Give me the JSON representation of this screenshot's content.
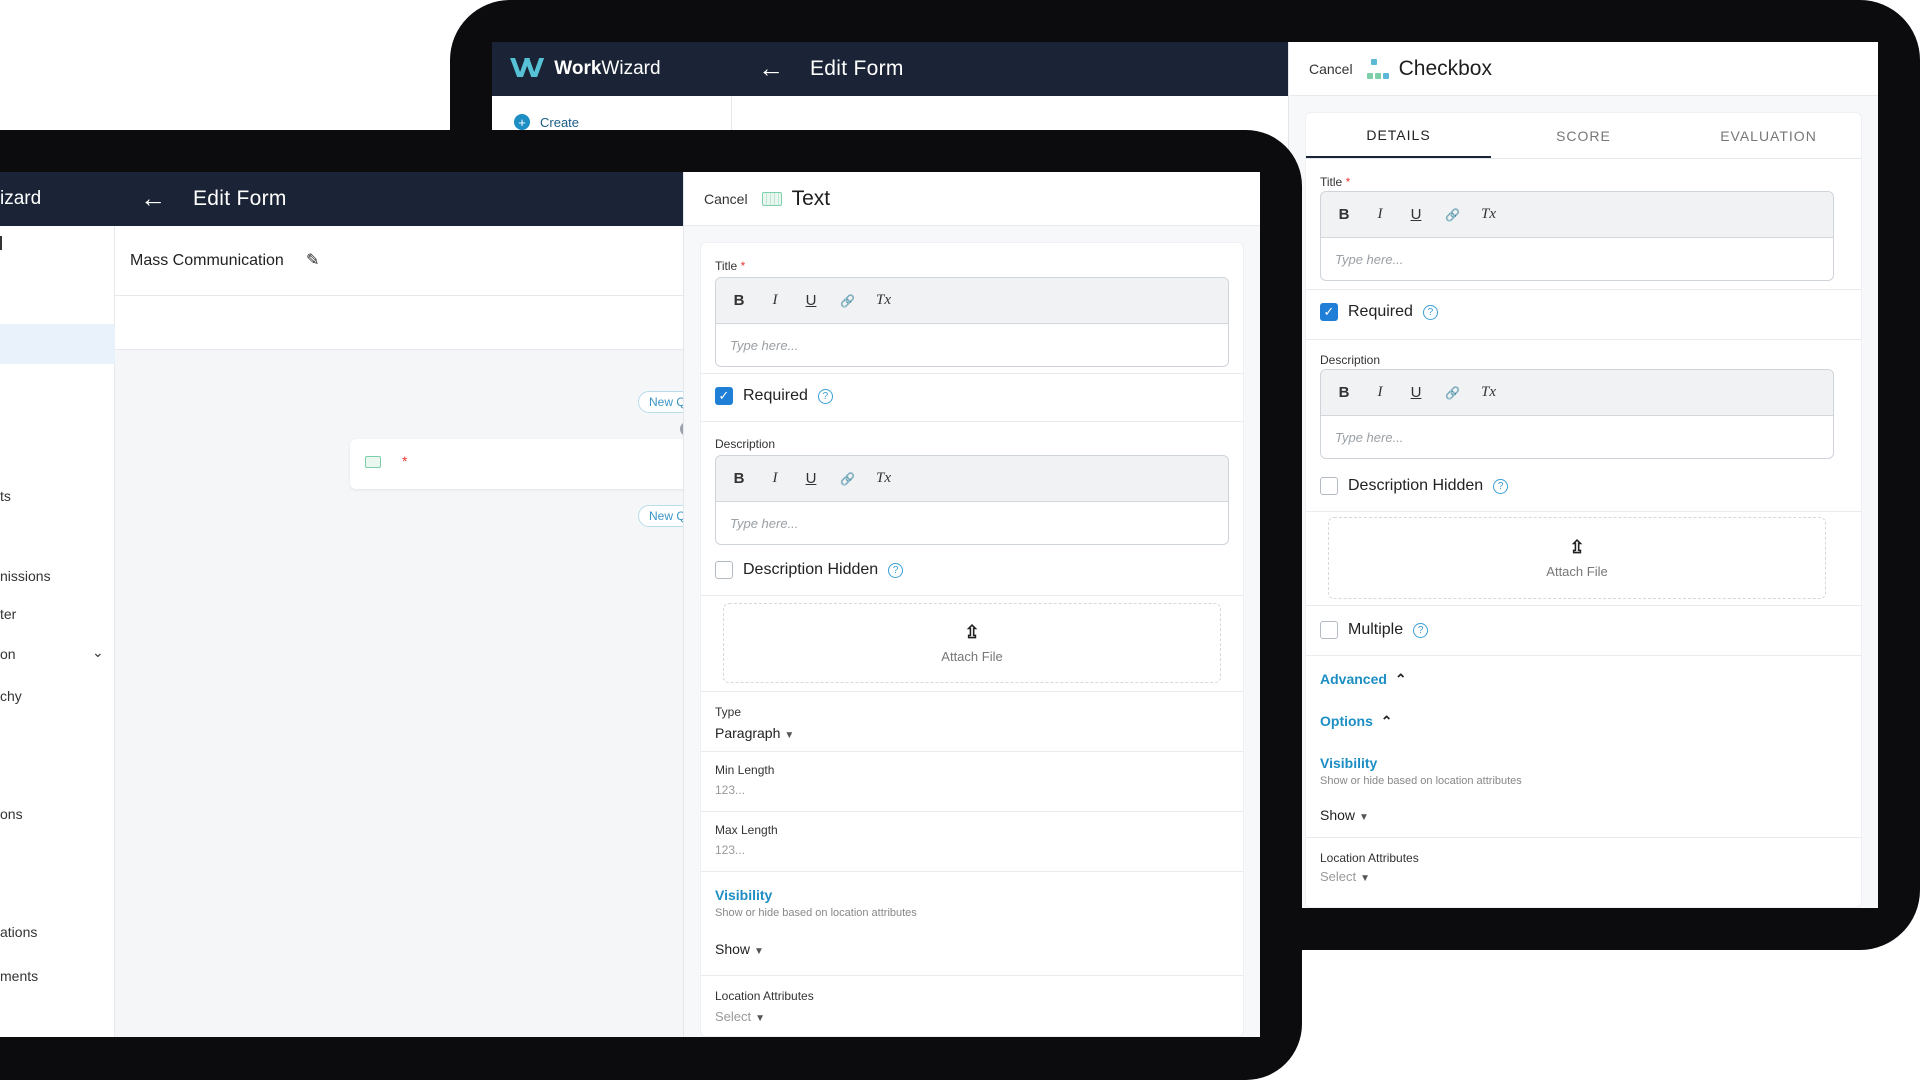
{
  "brand": {
    "name_bold": "Work",
    "name_rest": "Wizard",
    "front_fragment": "izard"
  },
  "header": {
    "title": "Edit Form"
  },
  "back_screen": {
    "sidebar": {
      "create_label": "Create"
    },
    "panel": {
      "cancel": "Cancel",
      "title": "Checkbox",
      "tabs": [
        "DETAILS",
        "SCORE",
        "EVALUATION"
      ],
      "title_label": "Title",
      "required_marker": "*",
      "title_placeholder": "Type here...",
      "required_label": "Required",
      "description_label": "Description",
      "description_placeholder": "Type here...",
      "description_hidden_label": "Description Hidden",
      "attach_label": "Attach File",
      "multiple_label": "Multiple",
      "advanced_label": "Advanced",
      "options_label": "Options",
      "visibility_label": "Visibility",
      "visibility_hint": "Show or hide based on location attributes",
      "visibility_value": "Show",
      "location_label": "Location Attributes",
      "location_value": "Select"
    }
  },
  "front_screen": {
    "form_name": "Mass Communication",
    "nav_items": [
      "ts",
      "nissions",
      "ter",
      "on",
      "chy",
      "ons",
      "ations",
      "ments"
    ],
    "canvas": {
      "new_pill_1": "New Q",
      "new_pill_2": "New Q",
      "question_marker": "*"
    },
    "panel": {
      "cancel": "Cancel",
      "title": "Text",
      "title_label": "Title",
      "required_marker": "*",
      "title_placeholder": "Type here...",
      "required_label": "Required",
      "description_label": "Description",
      "description_placeholder": "Type here...",
      "description_hidden_label": "Description Hidden",
      "attach_label": "Attach File",
      "type_label": "Type",
      "type_value": "Paragraph",
      "min_length_label": "Min Length",
      "min_length_placeholder": "123...",
      "max_length_label": "Max Length",
      "max_length_placeholder": "123...",
      "visibility_label": "Visibility",
      "visibility_hint": "Show or hide based on location attributes",
      "visibility_value": "Show",
      "location_label": "Location Attributes",
      "location_value": "Select"
    }
  },
  "editor_toolbar": {
    "bold": "B",
    "italic": "I",
    "underline": "U",
    "link": "🔗",
    "clear": "Tx"
  },
  "colors": {
    "header_bg": "#1b2436",
    "accent_blue": "#1c8ec4",
    "checkbox_blue": "#1f7ed6",
    "brand_teal": "#57c2d6"
  },
  "icons": [
    "back-arrow-icon",
    "checkbox-type-icon",
    "text-type-icon",
    "edit-icon",
    "upload-icon",
    "help-icon",
    "chevron-up-icon",
    "chevron-down-icon",
    "plus-circle-icon",
    "bold-icon",
    "italic-icon",
    "underline-icon",
    "link-icon",
    "clear-format-icon"
  ]
}
